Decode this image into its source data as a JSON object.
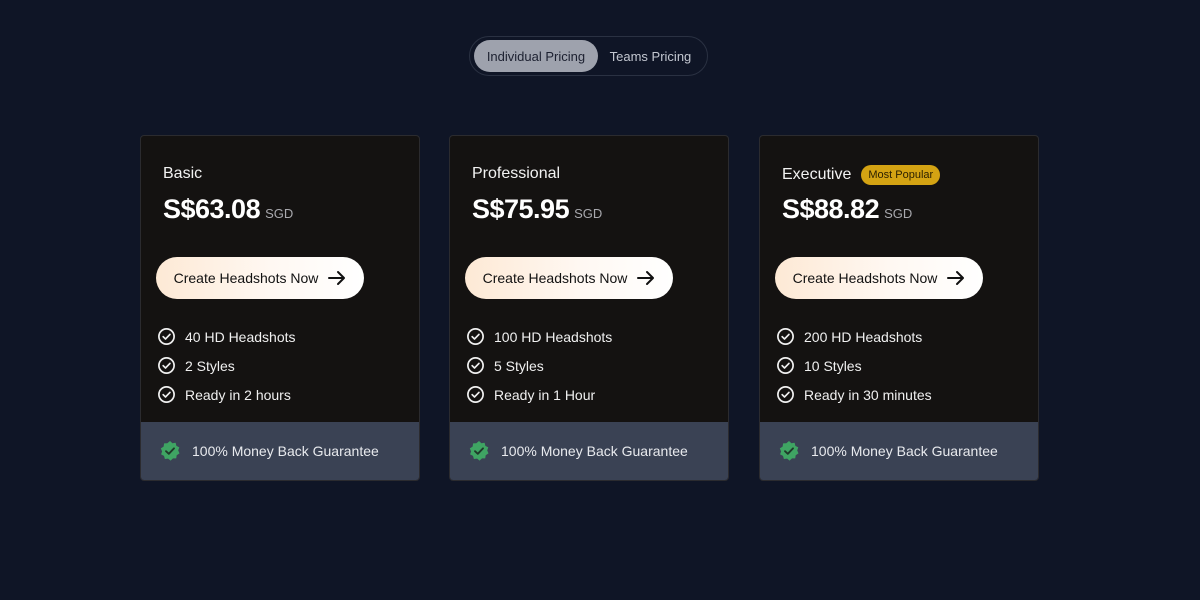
{
  "toggle": {
    "individual_label": "Individual Pricing",
    "teams_label": "Teams Pricing",
    "active": "individual"
  },
  "plans": [
    {
      "name": "Basic",
      "price": "S$63.08",
      "currency": "SGD",
      "cta_label": "Create Headshots Now",
      "features": [
        "40 HD Headshots",
        "2 Styles",
        "Ready in 2 hours"
      ],
      "guarantee": "100% Money Back Guarantee"
    },
    {
      "name": "Professional",
      "price": "S$75.95",
      "currency": "SGD",
      "cta_label": "Create Headshots Now",
      "features": [
        "100 HD Headshots",
        "5 Styles",
        "Ready in 1 Hour"
      ],
      "guarantee": "100% Money Back Guarantee"
    },
    {
      "name": "Executive",
      "badge": "Most Popular",
      "price": "S$88.82",
      "currency": "SGD",
      "cta_label": "Create Headshots Now",
      "features": [
        "200 HD Headshots",
        "10 Styles",
        "Ready in 30 minutes"
      ],
      "guarantee": "100% Money Back Guarantee"
    }
  ],
  "icons": {
    "cta": "arrow-right-icon",
    "feature": "check-circle-icon",
    "guarantee": "shield-check-icon"
  },
  "colors": {
    "background": "#0f1526",
    "card": "#141211",
    "guarantee_bar": "#3a4254",
    "badge": "#d4a313",
    "shield": "#3fa463",
    "toggle_active": "#9ea2ad"
  }
}
